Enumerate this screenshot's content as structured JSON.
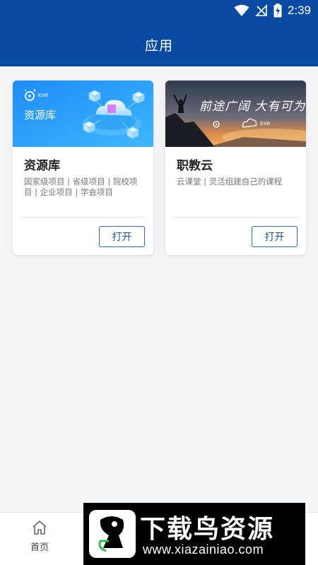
{
  "status_bar": {
    "time": "2:39",
    "icons": [
      "wifi-icon",
      "no-signal-icon",
      "battery-charging-icon"
    ]
  },
  "header": {
    "title": "应用"
  },
  "apps": [
    {
      "banner_label": "资源库",
      "banner_logo_text": "icve",
      "title": "资源库",
      "description": "国家级项目 | 省级项目 | 院校项目 | 企业项目 | 学会项目",
      "button_label": "打开"
    },
    {
      "banner_slogan": "前途广阔 大有可为",
      "banner_logo_text": "icve",
      "title": "职教云",
      "description": "云课堂 | 灵活组建自己的课程",
      "button_label": "打开"
    }
  ],
  "bottom_nav": {
    "items": [
      {
        "label": "首页",
        "icon": "home-icon"
      }
    ]
  },
  "watermark": {
    "title": "下载鸟资源",
    "url": "www.xiazainiao.com"
  },
  "colors": {
    "primary": "#0b4aa2",
    "button_border": "#2a68c2",
    "background": "#f3f4f6"
  }
}
